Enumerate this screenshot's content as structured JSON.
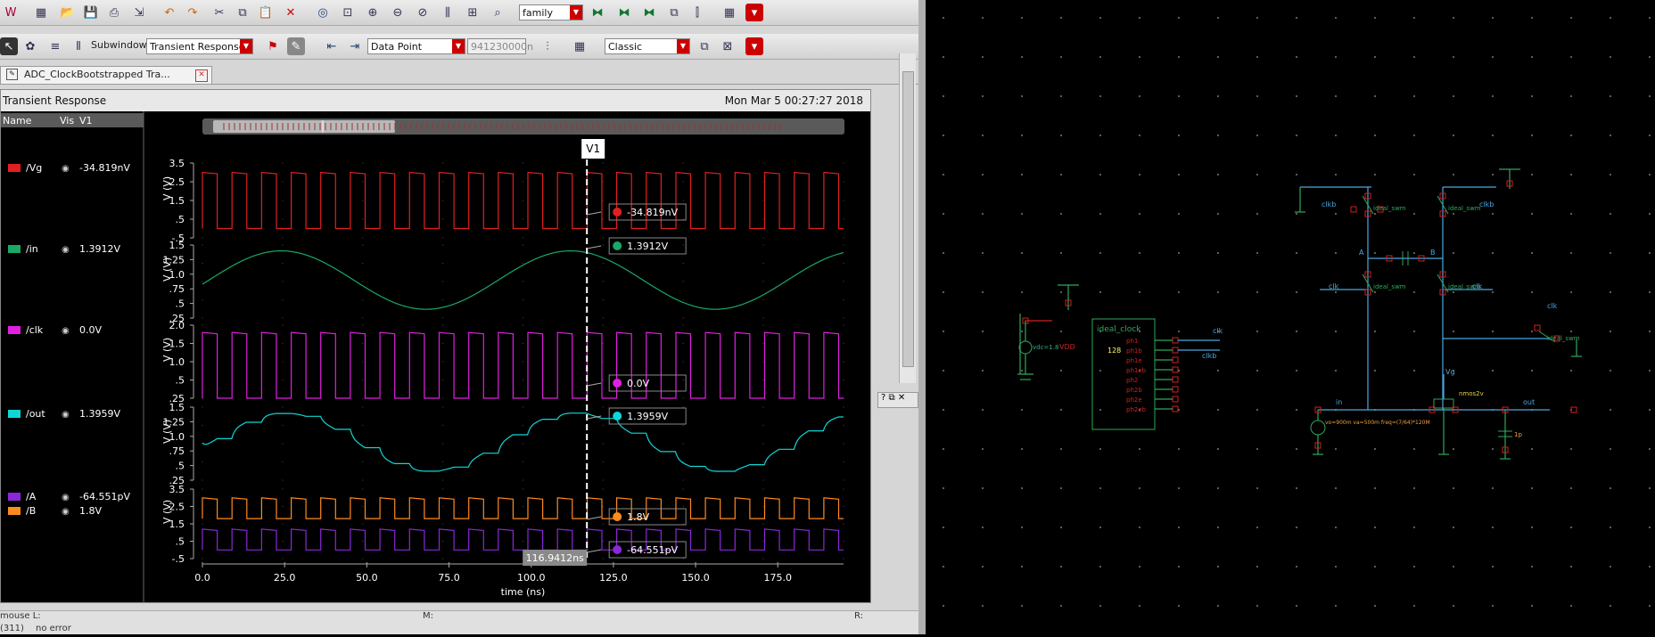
{
  "toolbar": {
    "family_combo": "family",
    "subwindows_label": "Subwindows:",
    "subwindow_combo": "Transient Response",
    "marker_mode_combo": "Data Point",
    "marker_value": "941230000n",
    "style_combo": "Classic"
  },
  "tab": {
    "title": "ADC_ClockBootstrapped Tra..."
  },
  "subwindow": {
    "title": "Transient Response",
    "timestamp": "Mon Mar 5 00:27:27 2018"
  },
  "legend_header": {
    "name": "Name",
    "vis": "Vis",
    "v1": "V1"
  },
  "legend": [
    {
      "name": "/Vg",
      "value": "-34.819nV",
      "color": "#e02020"
    },
    {
      "name": "/in",
      "value": "1.3912V",
      "color": "#19a866"
    },
    {
      "name": "/clk",
      "value": "0.0V",
      "color": "#e020e0"
    },
    {
      "name": "/out",
      "value": "1.3959V",
      "color": "#10d6d6"
    },
    {
      "name": "/A",
      "value": "-64.551pV",
      "color": "#8a28d8"
    },
    {
      "name": "/B",
      "value": "1.8V",
      "color": "#ff8a20"
    }
  ],
  "cursor": {
    "label": "V1",
    "time_label": "116.9412ns",
    "time": 116.9412
  },
  "chart_data": {
    "type": "line",
    "xlabel": "time (ns)",
    "xlim": [
      0,
      195
    ],
    "xticks": [
      "0.0",
      "25.0",
      "50.0",
      "75.0",
      "100.0",
      "125.0",
      "150.0",
      "175.0"
    ],
    "strips": [
      {
        "ylabel": "V (V)",
        "yticks": [
          "3.5",
          "2.5",
          "1.5",
          ".5",
          "-.5"
        ],
        "ylim": [
          -0.5,
          3.5
        ],
        "series": [
          {
            "name": "/Vg",
            "color": "#e02020",
            "kind": "square",
            "period": 9.0,
            "hi": 3.0,
            "lo": 0.0,
            "marker": "-34.819nV"
          }
        ]
      },
      {
        "ylabel": "V (V)",
        "yticks": [
          "1.5",
          "1.25",
          "1.0",
          ".75",
          ".5",
          ".25"
        ],
        "ylim": [
          0.25,
          1.5
        ],
        "series": [
          {
            "name": "/in",
            "color": "#19a866",
            "kind": "sine",
            "period": 88,
            "offset": 0.9,
            "amp": 0.5,
            "phase_peak": 24,
            "marker": "1.3912V"
          }
        ]
      },
      {
        "ylabel": "V (V)",
        "yticks": [
          "2.0",
          "1.5",
          "1.0",
          ".5",
          ".25"
        ],
        "ylim": [
          0,
          2.0
        ],
        "series": [
          {
            "name": "/clk",
            "color": "#e020e0",
            "kind": "square",
            "period": 9.0,
            "hi": 1.8,
            "lo": 0.0,
            "marker": "0.0V"
          }
        ]
      },
      {
        "ylabel": "V (V)",
        "yticks": [
          "1.5",
          "1.25",
          "1.0",
          ".75",
          ".5",
          ".25"
        ],
        "ylim": [
          0.25,
          1.5
        ],
        "series": [
          {
            "name": "/out",
            "color": "#10d6d6",
            "kind": "sample",
            "period": 88,
            "offset": 0.9,
            "amp": 0.5,
            "phase_peak": 24,
            "hold": 9.0,
            "marker": "1.3959V"
          }
        ]
      },
      {
        "ylabel": "V (V)",
        "yticks": [
          "3.5",
          "2.5",
          "1.5",
          ".5",
          "-.5"
        ],
        "ylim": [
          -0.5,
          3.5
        ],
        "series": [
          {
            "name": "/B",
            "color": "#ff8a20",
            "kind": "square",
            "period": 9.0,
            "hi": 3.0,
            "lo": 1.8,
            "marker": "1.8V"
          },
          {
            "name": "/A",
            "color": "#8a28d8",
            "kind": "square",
            "period": 9.0,
            "hi": 1.2,
            "lo": 0.0,
            "marker": "-64.551pV"
          }
        ]
      }
    ]
  },
  "status": {
    "mouse": "mouse L:",
    "middle": "M:",
    "right": "R:",
    "line2_left": "(311)",
    "line2_msg": "no error"
  },
  "schematic": {
    "clock_block": "ideal_clock",
    "clock_num": "128",
    "clock_pins": [
      "ph1",
      "ph1b",
      "ph1e",
      "ph1eb",
      "ph2",
      "ph2b",
      "ph2e",
      "ph2eb"
    ],
    "vdd_src": "vdc=1.8",
    "vdd_net": "VDD",
    "clk_out": "clk",
    "clkb_out": "clkb",
    "net_in": "in",
    "net_out": "out",
    "net_vg": "Vg",
    "net_a": "A",
    "net_b": "B",
    "switch_name": "ideal_swm",
    "cap": "1p",
    "src_params": "vo=900m va=500m freq=(7/64)*120M",
    "nmos": "nmos2v"
  }
}
